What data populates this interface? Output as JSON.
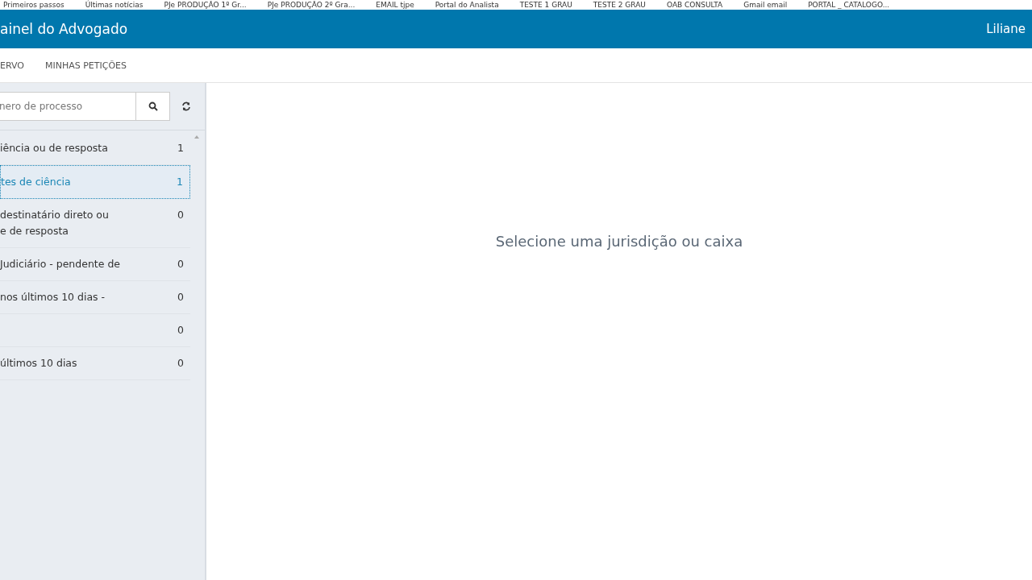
{
  "bookmarks": [
    {
      "label": "Primeiros passos"
    },
    {
      "label": "Últimas notícias"
    },
    {
      "label": "PJe PRODUÇÃO 1º Gr..."
    },
    {
      "label": "PJe PRODUÇÃO 2º Gra..."
    },
    {
      "label": "EMAIL tjpe"
    },
    {
      "label": "Portal do Analista"
    },
    {
      "label": "TESTE 1 GRAU"
    },
    {
      "label": "TESTE 2 GRAU"
    },
    {
      "label": "OAB CONSULTA"
    },
    {
      "label": "Gmail email"
    },
    {
      "label": "PORTAL _ CATALOGO..."
    }
  ],
  "header": {
    "title": "ainel do Advogado",
    "user": "Liliane"
  },
  "nav": [
    {
      "label": "ERVO"
    },
    {
      "label": "MINHAS PETIÇÕES"
    }
  ],
  "search": {
    "placeholder": "nero de processo"
  },
  "boxes": [
    {
      "label": "iência ou de resposta",
      "count": "1",
      "selected": false
    },
    {
      "label": "tes de ciência",
      "count": "1",
      "selected": true
    },
    {
      "label": "destinatário direto ou\ne de resposta",
      "count": "0",
      "selected": false
    },
    {
      "label": "Judiciário - pendente de",
      "count": "0",
      "selected": false
    },
    {
      "label": "nos últimos 10 dias -",
      "count": "0",
      "selected": false
    },
    {
      "count": "0",
      "selected": false
    },
    {
      "label": "últimos 10 dias",
      "count": "0",
      "selected": false
    }
  ],
  "message": "Selecione uma jurisdição ou caixa"
}
